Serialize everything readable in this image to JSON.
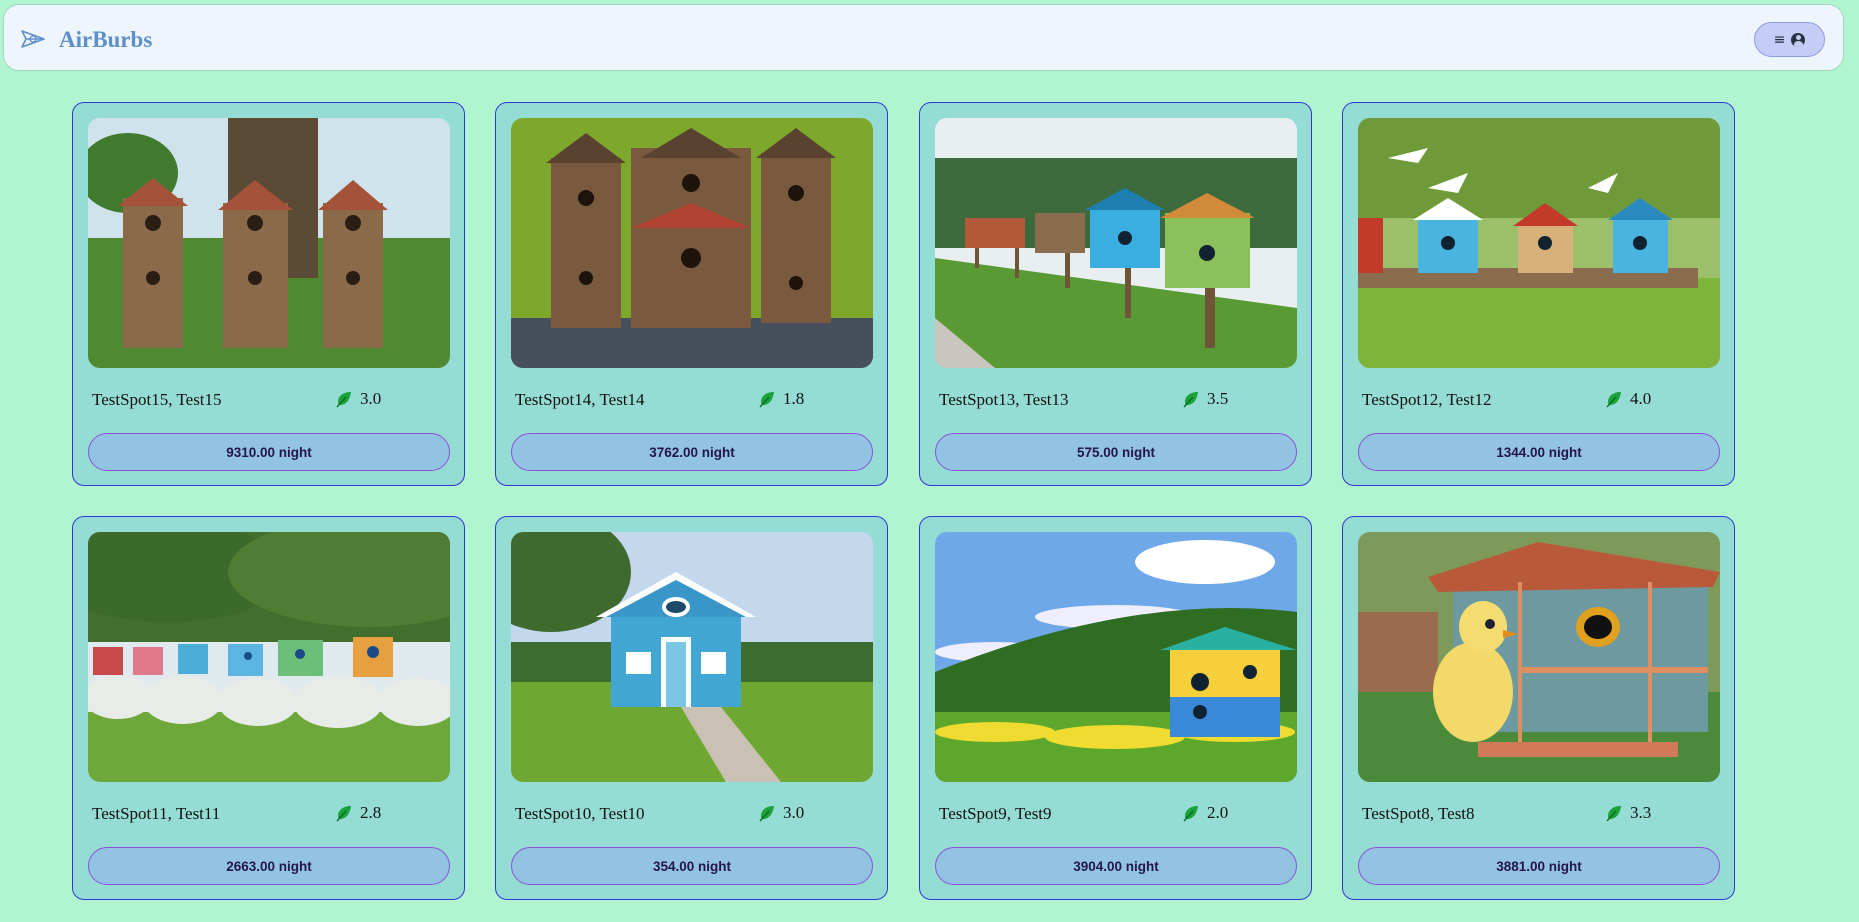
{
  "header": {
    "brand": "AirBurbs",
    "logo_icon": "paper-plane-icon",
    "menu_icon": "hamburger-icon",
    "user_icon": "user-circle-icon"
  },
  "listings": [
    {
      "title": "TestSpot15, Test15",
      "rating": "3.0",
      "price": "9310.00 night",
      "image": "stacked wooden birdhouses with birds on lawn"
    },
    {
      "title": "TestSpot14, Test14",
      "rating": "1.8",
      "price": "3762.00 night",
      "image": "rustic multi-tier birdhouse tower on green background"
    },
    {
      "title": "TestSpot13, Test13",
      "rating": "3.5",
      "price": "575.00 night",
      "image": "row of colorful birdhouses on posts along a path"
    },
    {
      "title": "TestSpot12, Test12",
      "rating": "4.0",
      "price": "1344.00 night",
      "image": "birdhouses on a wooden bench with white birds"
    },
    {
      "title": "TestSpot11, Test11",
      "rating": "2.8",
      "price": "2663.00 night",
      "image": "colorful birdhouses along a hedge of white flowers"
    },
    {
      "title": "TestSpot10, Test10",
      "rating": "3.0",
      "price": "354.00 night",
      "image": "blue birdhouse cottage on a lawn"
    },
    {
      "title": "TestSpot9, Test9",
      "rating": "2.0",
      "price": "3904.00 night",
      "image": "yellow and blue birdhouse on a green hill"
    },
    {
      "title": "TestSpot8, Test8",
      "rating": "3.3",
      "price": "3881.00 night",
      "image": "yellow chick beside a blue wooden shed"
    }
  ],
  "colors": {
    "background": "#b0f5d0",
    "card": "#95ddd4",
    "card_border": "#2f37d6",
    "price_button": "#93c3e3",
    "leaf": "#1aa33a",
    "brand": "#5f8fc8"
  }
}
